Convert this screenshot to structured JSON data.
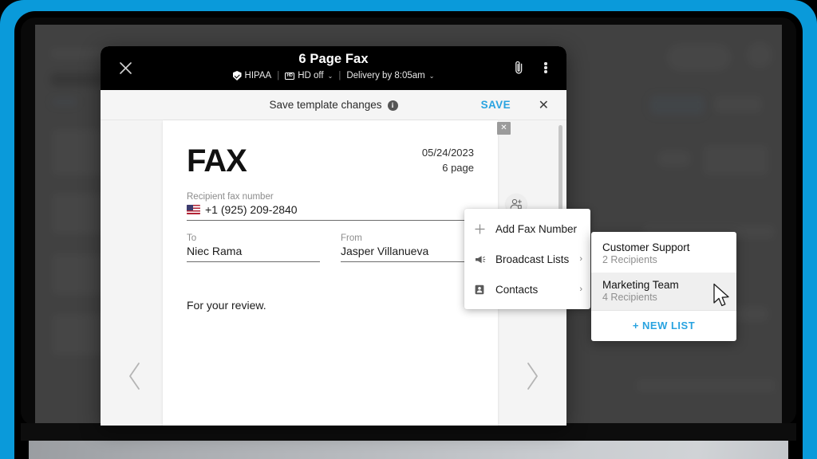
{
  "device": {
    "frame_color": "#0a9ada",
    "bezel_color": "#090909",
    "app_background_color": "#4a4a4a"
  },
  "modal": {
    "header": {
      "title": "6 Page Fax",
      "close_icon": "close-icon",
      "attachment_icon": "paperclip-icon",
      "overflow_icon": "kebab-menu-icon",
      "meta": {
        "hipaa_label": "HIPAA",
        "hipaa_icon": "shield-check-icon",
        "separator": "|",
        "hd_label": "HD off",
        "hd_badge_text": "HD",
        "hd_caret": "⌄",
        "delivery_label": "Delivery by 8:05am",
        "delivery_caret": "⌄"
      }
    },
    "save_bar": {
      "message": "Save template changes",
      "info_icon": "info-icon",
      "info_glyph": "i",
      "save_label": "SAVE",
      "close_glyph": "✕",
      "save_color": "#29a3e0"
    },
    "preview": {
      "prev_chevron": "‹",
      "next_chevron": "›",
      "page_close_glyph": "✕",
      "document": {
        "heading": "FAX",
        "date": "05/24/2023",
        "pages": "6 page",
        "recipient_label": "Recipient fax number",
        "recipient_value": "+1 (925) 209-2840",
        "flag_icon": "us-flag-icon",
        "to_label": "To",
        "to_value": "Niec Rama",
        "from_label": "From",
        "from_value": "Jasper Villanueva",
        "body": "For your review."
      },
      "add_recipient_icon": "add-person-icon"
    }
  },
  "context_menu": {
    "items": [
      {
        "label": "Add Fax Number",
        "icon": "plus-icon",
        "has_submenu": false
      },
      {
        "label": "Broadcast Lists",
        "icon": "megaphone-icon",
        "has_submenu": true
      },
      {
        "label": "Contacts",
        "icon": "contact-card-icon",
        "has_submenu": true
      }
    ],
    "arrow_glyph": "›"
  },
  "submenu": {
    "lists": [
      {
        "name": "Customer Support",
        "recipients": "2 Recipients",
        "hovered": false
      },
      {
        "name": "Marketing Team",
        "recipients": "4 Recipients",
        "hovered": true
      }
    ],
    "new_list_label": "NEW LIST",
    "new_list_plus": "+",
    "new_list_color": "#29a3e0"
  },
  "cursor": {
    "icon": "mouse-pointer-icon"
  }
}
